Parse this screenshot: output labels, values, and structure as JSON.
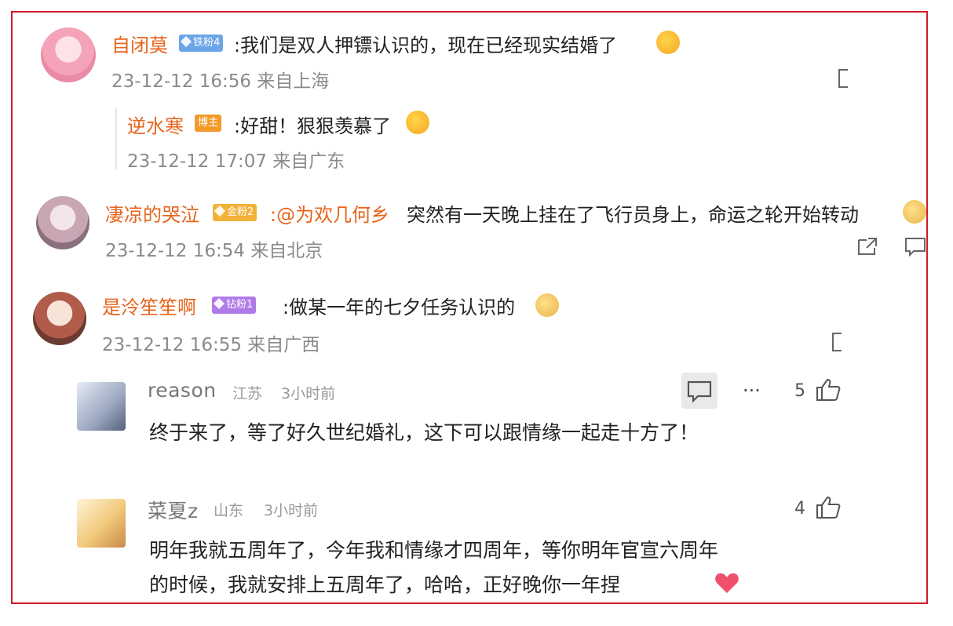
{
  "comments": [
    {
      "user": "自闭莫",
      "badge": "铁粉4",
      "text": ":我们是双人押镖认识的，现在已经现实结婚了",
      "meta": "23-12-12 16:56 来自上海",
      "reply": {
        "user": "逆水寒",
        "badge": "博主",
        "text": ":好甜！狠狠羡慕了",
        "meta": "23-12-12 17:07 来自广东"
      }
    },
    {
      "user": "凄凉的哭泣",
      "badge": "金粉2",
      "text_mention": ":@为欢几何乡",
      "text": "突然有一天晚上挂在了飞行员身上，命运之轮开始转动",
      "meta": "23-12-12 16:54 来自北京"
    },
    {
      "user": "是泠笙笙啊",
      "badge": "钻粉1",
      "text": ":做某一年的七夕任务认识的",
      "meta": "23-12-12 16:55 来自广西"
    }
  ],
  "subcomments": [
    {
      "user": "reason",
      "location": "江苏",
      "time": "3小时前",
      "likes": "5",
      "more": "···",
      "text": "终于来了，等了好久世纪婚礼，这下可以跟情缘一起走十方了！"
    },
    {
      "user": "菜夏z",
      "location": "山东",
      "time": "3小时前",
      "likes": "4",
      "text_line1": "明年我就五周年了，今年我和情缘才四周年，等你明年官宣六周年",
      "text_line2": "的时候，我就安排上五周年了，哈哈，正好晚你一年捏"
    }
  ],
  "colors": {
    "frame": "#d11a2a",
    "username": "#e8641c",
    "badge_iron": "#6aa6e8",
    "badge_owner": "#f39a2a",
    "badge_gold": "#f2b23a",
    "badge_diamond": "#b07be8"
  }
}
